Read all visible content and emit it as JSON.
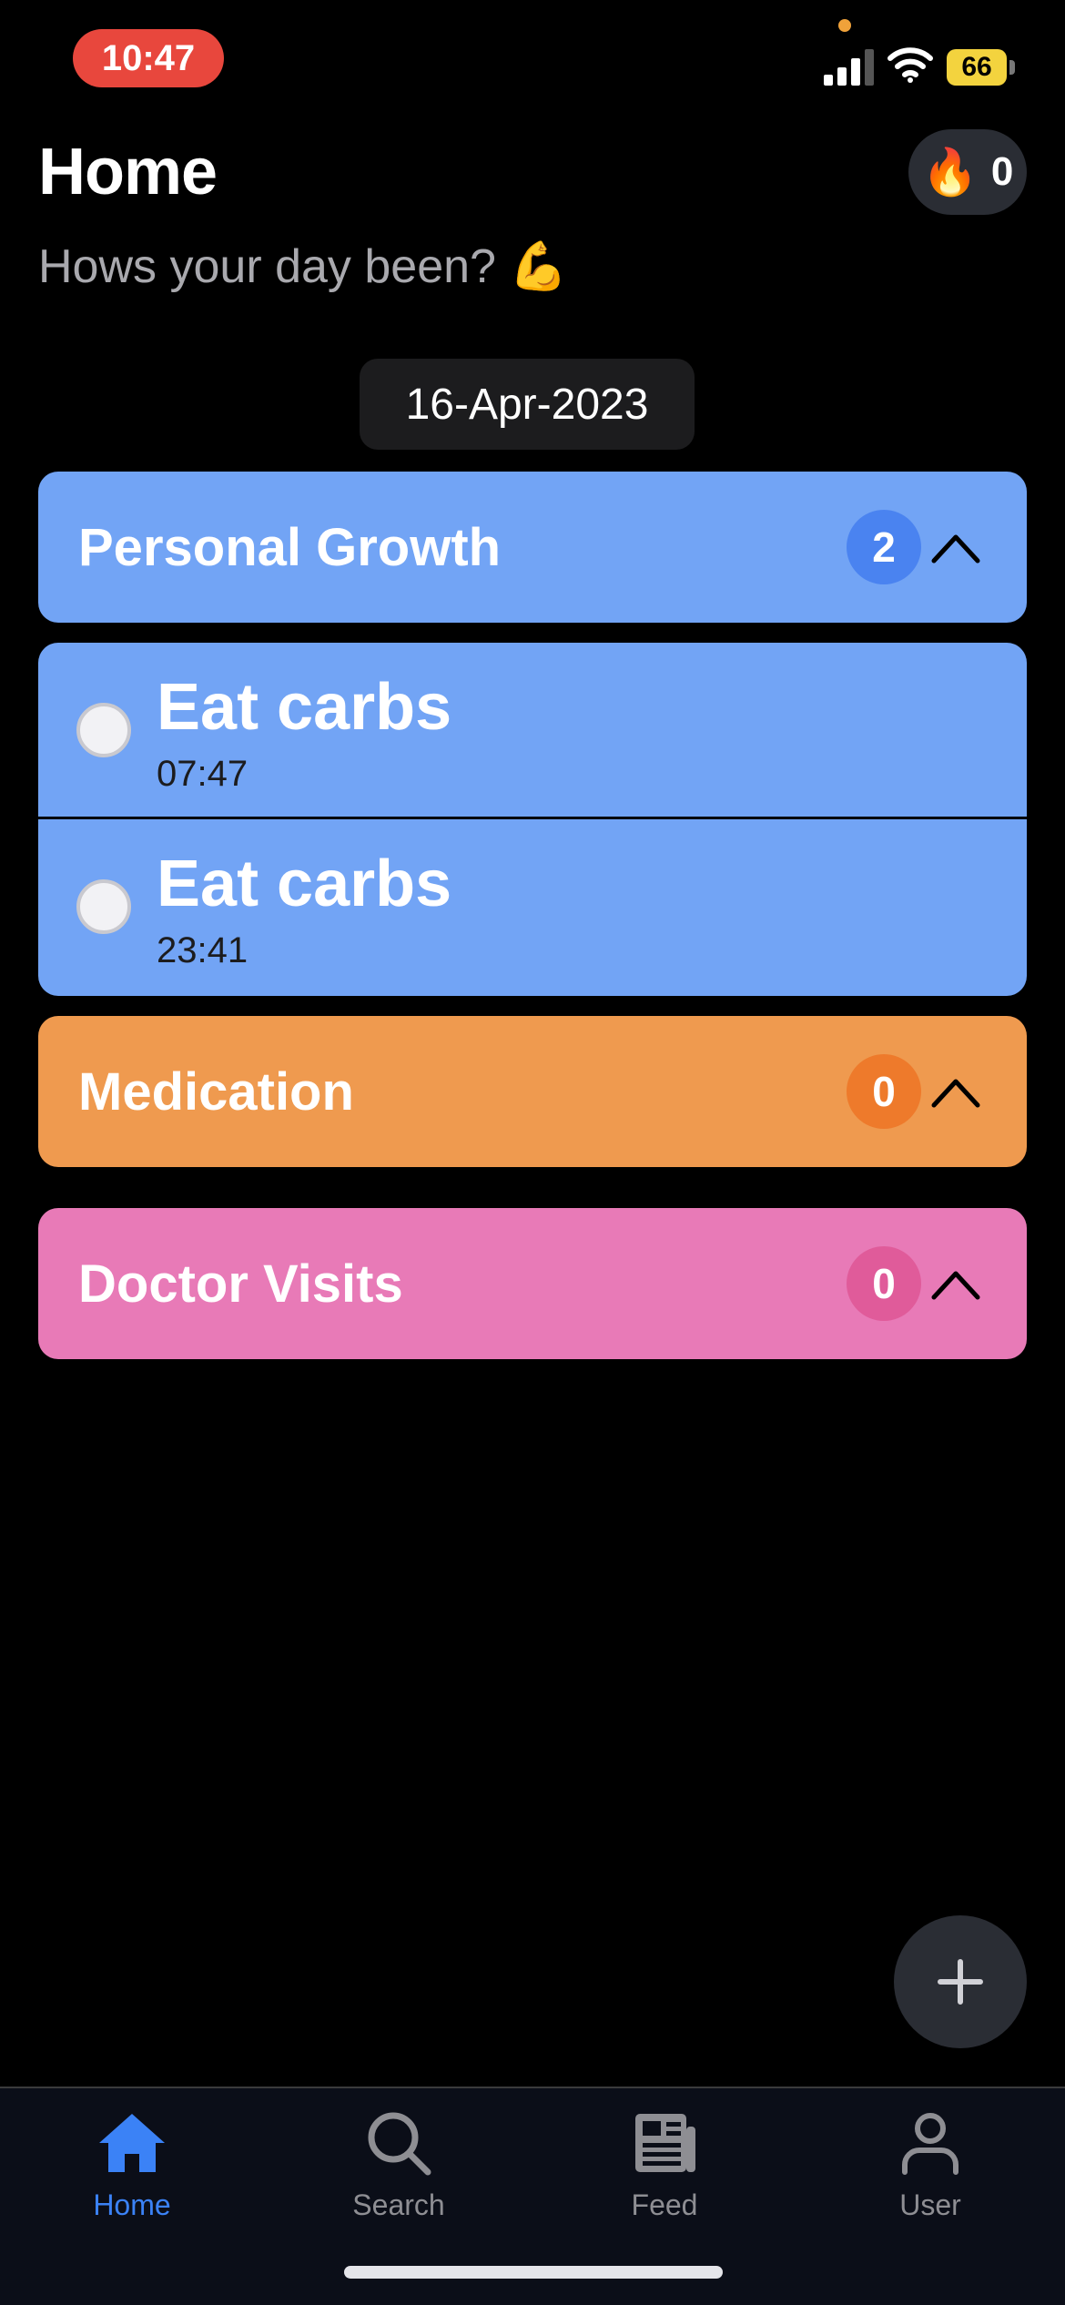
{
  "status_bar": {
    "time": "10:47",
    "battery": "66"
  },
  "header": {
    "title": "Home",
    "subtitle": "Hows your day been? 💪",
    "streak_icon": "fire-icon",
    "streak_count": "0"
  },
  "date": "16-Apr-2023",
  "categories": [
    {
      "label": "Personal Growth",
      "count": "2",
      "color": "#72a4f5",
      "badge_color": "#4a83f0",
      "expanded": true
    },
    {
      "label": "Medication",
      "count": "0",
      "color": "#ef9a4f",
      "badge_color": "#ee7a2b"
    },
    {
      "label": "Doctor Visits",
      "count": "0",
      "color": "#e87ab7",
      "badge_color": "#e05b9a"
    }
  ],
  "tasks": [
    {
      "title": "Eat carbs",
      "time": "07:47"
    },
    {
      "title": "Eat carbs",
      "time": "23:41"
    }
  ],
  "fab": {
    "icon": "plus-icon"
  },
  "tabs": [
    {
      "label": "Home",
      "icon": "home-icon",
      "active": true
    },
    {
      "label": "Search",
      "icon": "search-icon"
    },
    {
      "label": "Feed",
      "icon": "newspaper-icon"
    },
    {
      "label": "User",
      "icon": "user-icon"
    }
  ],
  "colors": {
    "accent": "#3b82f6",
    "background": "#000000"
  }
}
